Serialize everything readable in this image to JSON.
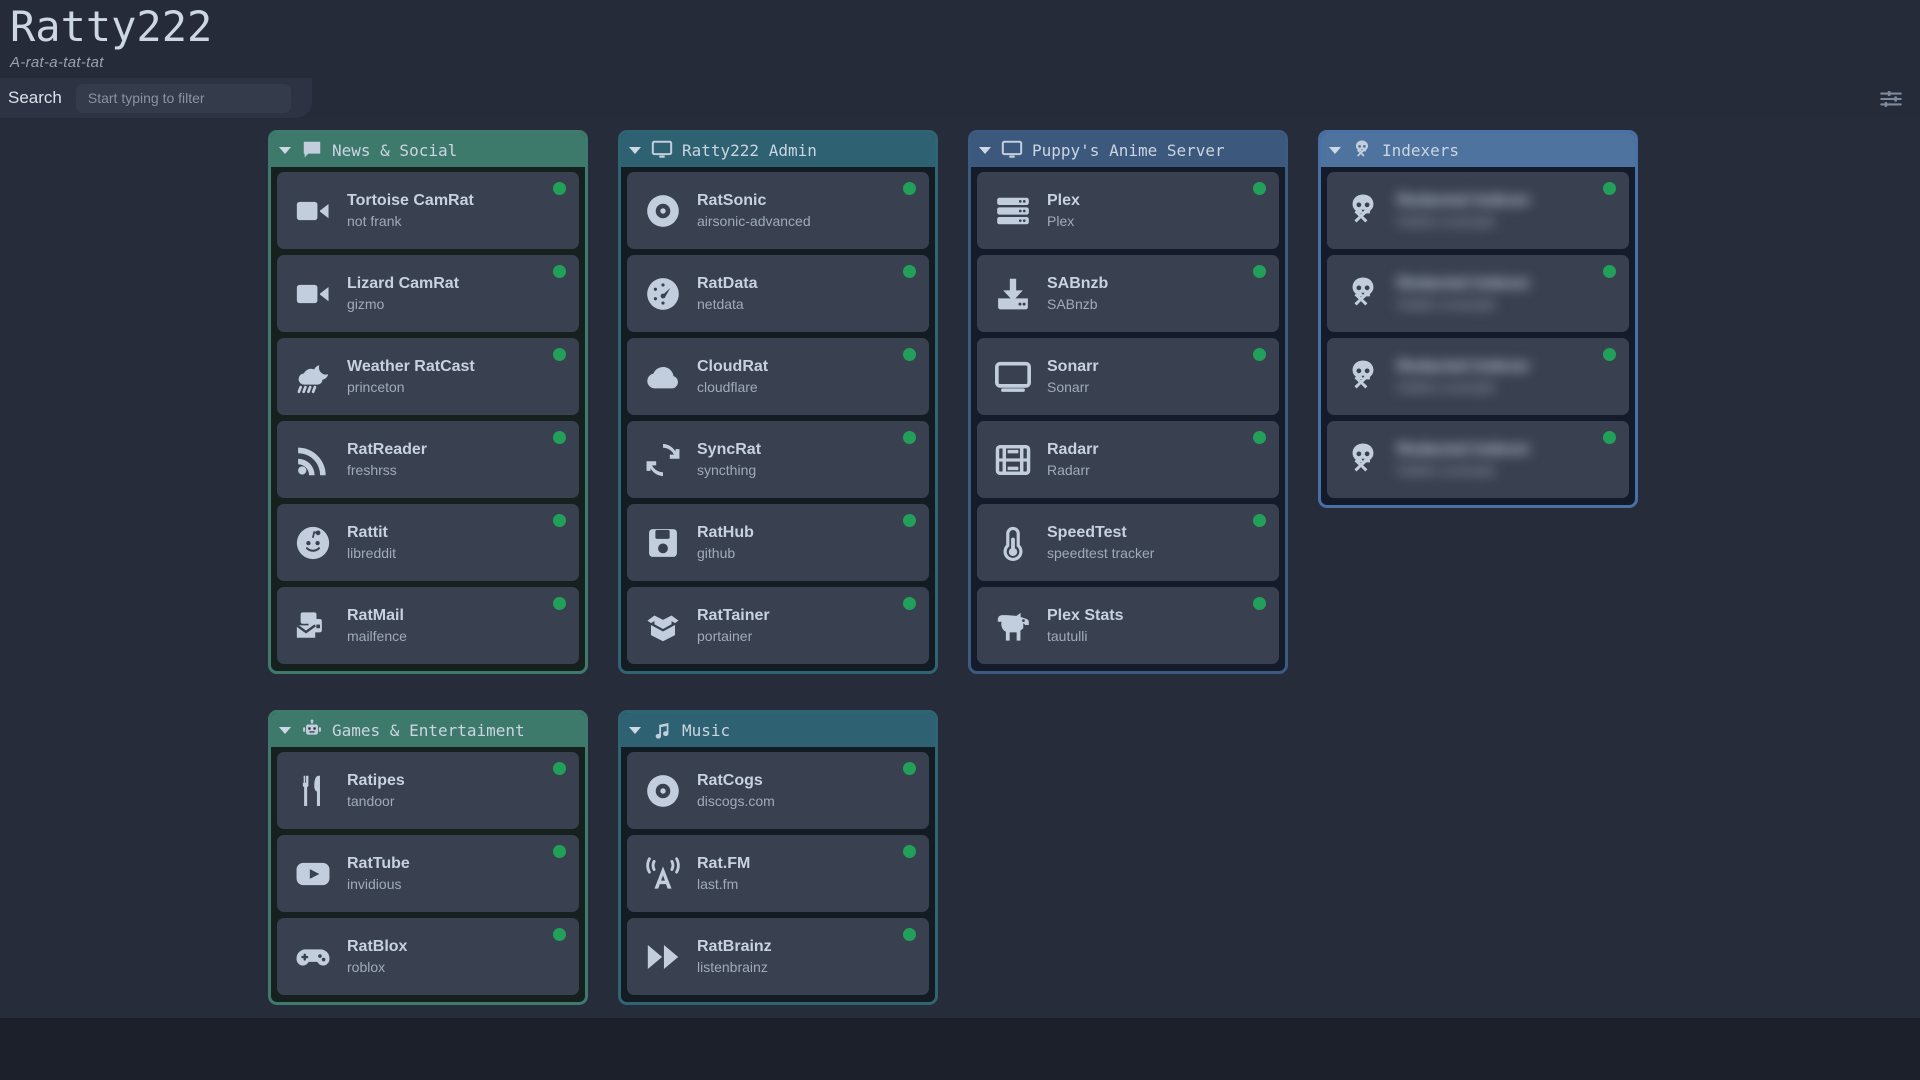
{
  "header": {
    "title": "Ratty222",
    "subtitle": "A-rat-a-tat-tat",
    "search_label": "Search",
    "search_value": "",
    "search_placeholder": "Start typing to filter",
    "settings_icon": "sliders-icon"
  },
  "colors": {
    "page_background": "#1b202b",
    "board_background": "#262c39",
    "card_background": "#39404f",
    "status_online": "#22a05a",
    "group_green_header": "#3d7a6c",
    "group_teal_header": "#2e6171",
    "group_blue_header": "#3c587d",
    "group_blue2_header": "#4f739f"
  },
  "groups": [
    {
      "id": "news-social",
      "title": "News & Social",
      "icon": "chat-bubble-icon",
      "theme": "green",
      "collapsed": false,
      "services": [
        {
          "name": "Tortoise CamRat",
          "sub": "not frank",
          "icon": "video-camera-icon",
          "status": "online",
          "blurred": false
        },
        {
          "name": "Lizard CamRat",
          "sub": "gizmo",
          "icon": "video-camera-icon",
          "status": "online",
          "blurred": false
        },
        {
          "name": "Weather RatCast",
          "sub": "princeton",
          "icon": "weather-rain-moon-icon",
          "status": "online",
          "blurred": false
        },
        {
          "name": "RatReader",
          "sub": "freshrss",
          "icon": "rss-icon",
          "status": "online",
          "blurred": false
        },
        {
          "name": "Rattit",
          "sub": "libreddit",
          "icon": "reddit-alien-icon",
          "status": "online",
          "blurred": false
        },
        {
          "name": "RatMail",
          "sub": "mailfence",
          "icon": "envelope-stack-icon",
          "status": "online",
          "blurred": false
        }
      ]
    },
    {
      "id": "ratty222-admin",
      "title": "Ratty222 Admin",
      "icon": "desktop-monitor-icon",
      "theme": "teal",
      "collapsed": false,
      "services": [
        {
          "name": "RatSonic",
          "sub": "airsonic-advanced",
          "icon": "vinyl-disc-icon",
          "status": "online",
          "blurred": false
        },
        {
          "name": "RatData",
          "sub": "netdata",
          "icon": "gauge-icon",
          "status": "online",
          "blurred": false
        },
        {
          "name": "CloudRat",
          "sub": "cloudflare",
          "icon": "cloud-icon",
          "status": "online",
          "blurred": false
        },
        {
          "name": "SyncRat",
          "sub": "syncthing",
          "icon": "sync-arrows-icon",
          "status": "online",
          "blurred": false
        },
        {
          "name": "RatHub",
          "sub": "github",
          "icon": "floppy-disk-icon",
          "status": "online",
          "blurred": false
        },
        {
          "name": "RatTainer",
          "sub": "portainer",
          "icon": "open-box-icon",
          "status": "online",
          "blurred": false
        }
      ]
    },
    {
      "id": "puppys-anime-server",
      "title": "Puppy's Anime Server",
      "icon": "desktop-monitor-icon",
      "theme": "blue",
      "collapsed": false,
      "services": [
        {
          "name": "Plex",
          "sub": "Plex",
          "icon": "server-rack-icon",
          "status": "online",
          "blurred": false
        },
        {
          "name": "SABnzb",
          "sub": "SABnzb",
          "icon": "download-tray-icon",
          "status": "online",
          "blurred": false
        },
        {
          "name": "Sonarr",
          "sub": "Sonarr",
          "icon": "television-icon",
          "status": "online",
          "blurred": false
        },
        {
          "name": "Radarr",
          "sub": "Radarr",
          "icon": "film-strip-icon",
          "status": "online",
          "blurred": false
        },
        {
          "name": "SpeedTest",
          "sub": "speedtest tracker",
          "icon": "thermometer-icon",
          "status": "online",
          "blurred": false
        },
        {
          "name": "Plex Stats",
          "sub": "tautulli",
          "icon": "dog-icon",
          "status": "online",
          "blurred": false
        }
      ]
    },
    {
      "id": "indexers",
      "title": "Indexers",
      "icon": "skull-crossbones-icon",
      "theme": "blue2",
      "collapsed": false,
      "services": [
        {
          "name": "",
          "sub": "",
          "icon": "skull-crossbones-icon",
          "status": "online",
          "blurred": true
        },
        {
          "name": "",
          "sub": "",
          "icon": "skull-crossbones-icon",
          "status": "online",
          "blurred": true
        },
        {
          "name": "",
          "sub": "",
          "icon": "skull-crossbones-icon",
          "status": "online",
          "blurred": true
        },
        {
          "name": "",
          "sub": "",
          "icon": "skull-crossbones-icon",
          "status": "online",
          "blurred": true
        }
      ]
    },
    {
      "id": "games-entertaiment",
      "title": "Games & Entertaiment",
      "icon": "robot-icon",
      "theme": "green",
      "collapsed": false,
      "services": [
        {
          "name": "Ratipes",
          "sub": "tandoor",
          "icon": "fork-knife-icon",
          "status": "online",
          "blurred": false
        },
        {
          "name": "RatTube",
          "sub": "invidious",
          "icon": "youtube-play-icon",
          "status": "online",
          "blurred": false
        },
        {
          "name": "RatBlox",
          "sub": "roblox",
          "icon": "gamepad-icon",
          "status": "online",
          "blurred": false
        }
      ]
    },
    {
      "id": "music",
      "title": "Music",
      "icon": "music-note-icon",
      "theme": "teal",
      "collapsed": false,
      "services": [
        {
          "name": "RatCogs",
          "sub": "discogs.com",
          "icon": "vinyl-disc-icon",
          "status": "online",
          "blurred": false
        },
        {
          "name": "Rat.FM",
          "sub": "last.fm",
          "icon": "broadcast-tower-icon",
          "status": "online",
          "blurred": false
        },
        {
          "name": "RatBrainz",
          "sub": "listenbrainz",
          "icon": "fast-forward-icon",
          "status": "online",
          "blurred": false
        }
      ]
    }
  ],
  "layout": {
    "columns": [
      [
        "news-social",
        "games-entertaiment"
      ],
      [
        "ratty222-admin",
        "music"
      ],
      [
        "puppys-anime-server"
      ],
      [
        "indexers"
      ]
    ]
  }
}
